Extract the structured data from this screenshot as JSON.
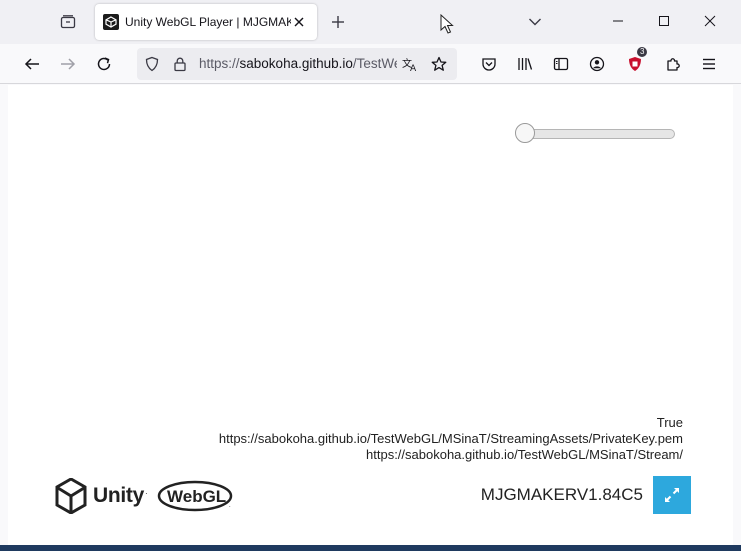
{
  "browser": {
    "tab": {
      "title": "Unity WebGL Player | MJGMAKER"
    },
    "url": {
      "prefix": "https://",
      "host": "sabokoha.github.io",
      "path": "/TestWebGL/MSinaT/"
    },
    "extension_badge": "3",
    "icons": {
      "tab_overview": "tab-overview-icon",
      "favicon": "unity-favicon-icon",
      "close": "close-icon",
      "new_tab": "plus-icon",
      "list_all_tabs": "chevron-down-icon",
      "minimize": "minimize-icon",
      "maximize": "maximize-icon",
      "window_close": "window-close-icon",
      "back": "back-arrow-icon",
      "forward": "forward-arrow-icon",
      "reload": "reload-icon",
      "tracking_protection": "shield-icon",
      "lock": "lock-icon",
      "translate": "translate-icon",
      "bookmark": "star-icon",
      "pocket": "pocket-icon",
      "library": "library-icon",
      "reader": "sidebar-icon",
      "account": "account-icon",
      "ublock": "ublock-icon",
      "extensions": "puzzle-icon",
      "menu": "hamburger-menu-icon"
    }
  },
  "page": {
    "slider": {
      "value_fraction": 0.0
    },
    "info_lines": [
      "True",
      "https://sabokoha.github.io/TestWebGL/MSinaT/StreamingAssets/PrivateKey.pem",
      "https://sabokoha.github.io/TestWebGL/MSinaT/Stream/"
    ],
    "footer": {
      "unity_logo_text": "Unity",
      "webgl_logo_text": "WebGL",
      "build_title": "MJGMAKERV1.84C5",
      "fullscreen_icon": "fullscreen-icon"
    }
  },
  "colors": {
    "fullscreen_button": "#2da8dd",
    "ublock": "#c8102e"
  }
}
